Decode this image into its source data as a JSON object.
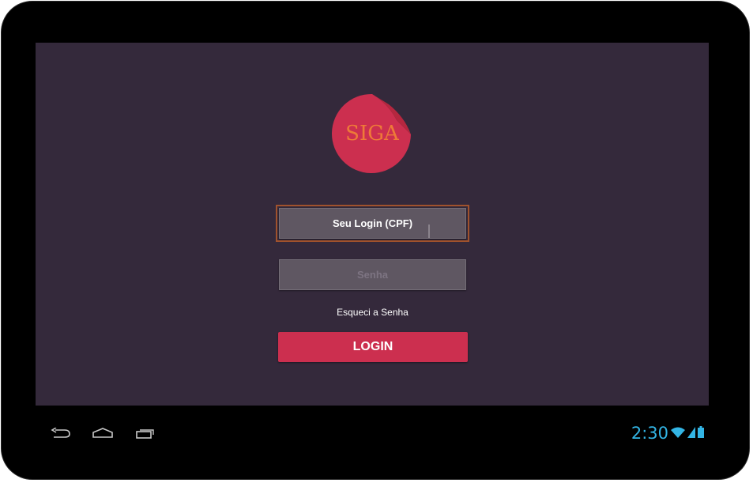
{
  "app": {
    "logo_text": "SIGA",
    "logo_color": "#cc2f4f",
    "logo_text_color": "#ee7a38"
  },
  "form": {
    "login_placeholder": "Seu Login (CPF)",
    "password_placeholder": "Senha",
    "forgot_password_label": "Esqueci a Senha",
    "login_button_label": "LOGIN"
  },
  "navbar": {
    "back_icon": "back-icon",
    "home_icon": "home-icon",
    "recent_apps_icon": "recent-apps-icon"
  },
  "status_bar": {
    "time": "2:30",
    "wifi_icon": "wifi-icon",
    "signal_icon": "signal-icon",
    "battery_icon": "battery-icon",
    "accent_color": "#33b5e5"
  },
  "colors": {
    "screen_background": "#34293b",
    "field_background": "#5f5762",
    "focus_outline": "#a0522d",
    "button_background": "#cc2f4f"
  }
}
